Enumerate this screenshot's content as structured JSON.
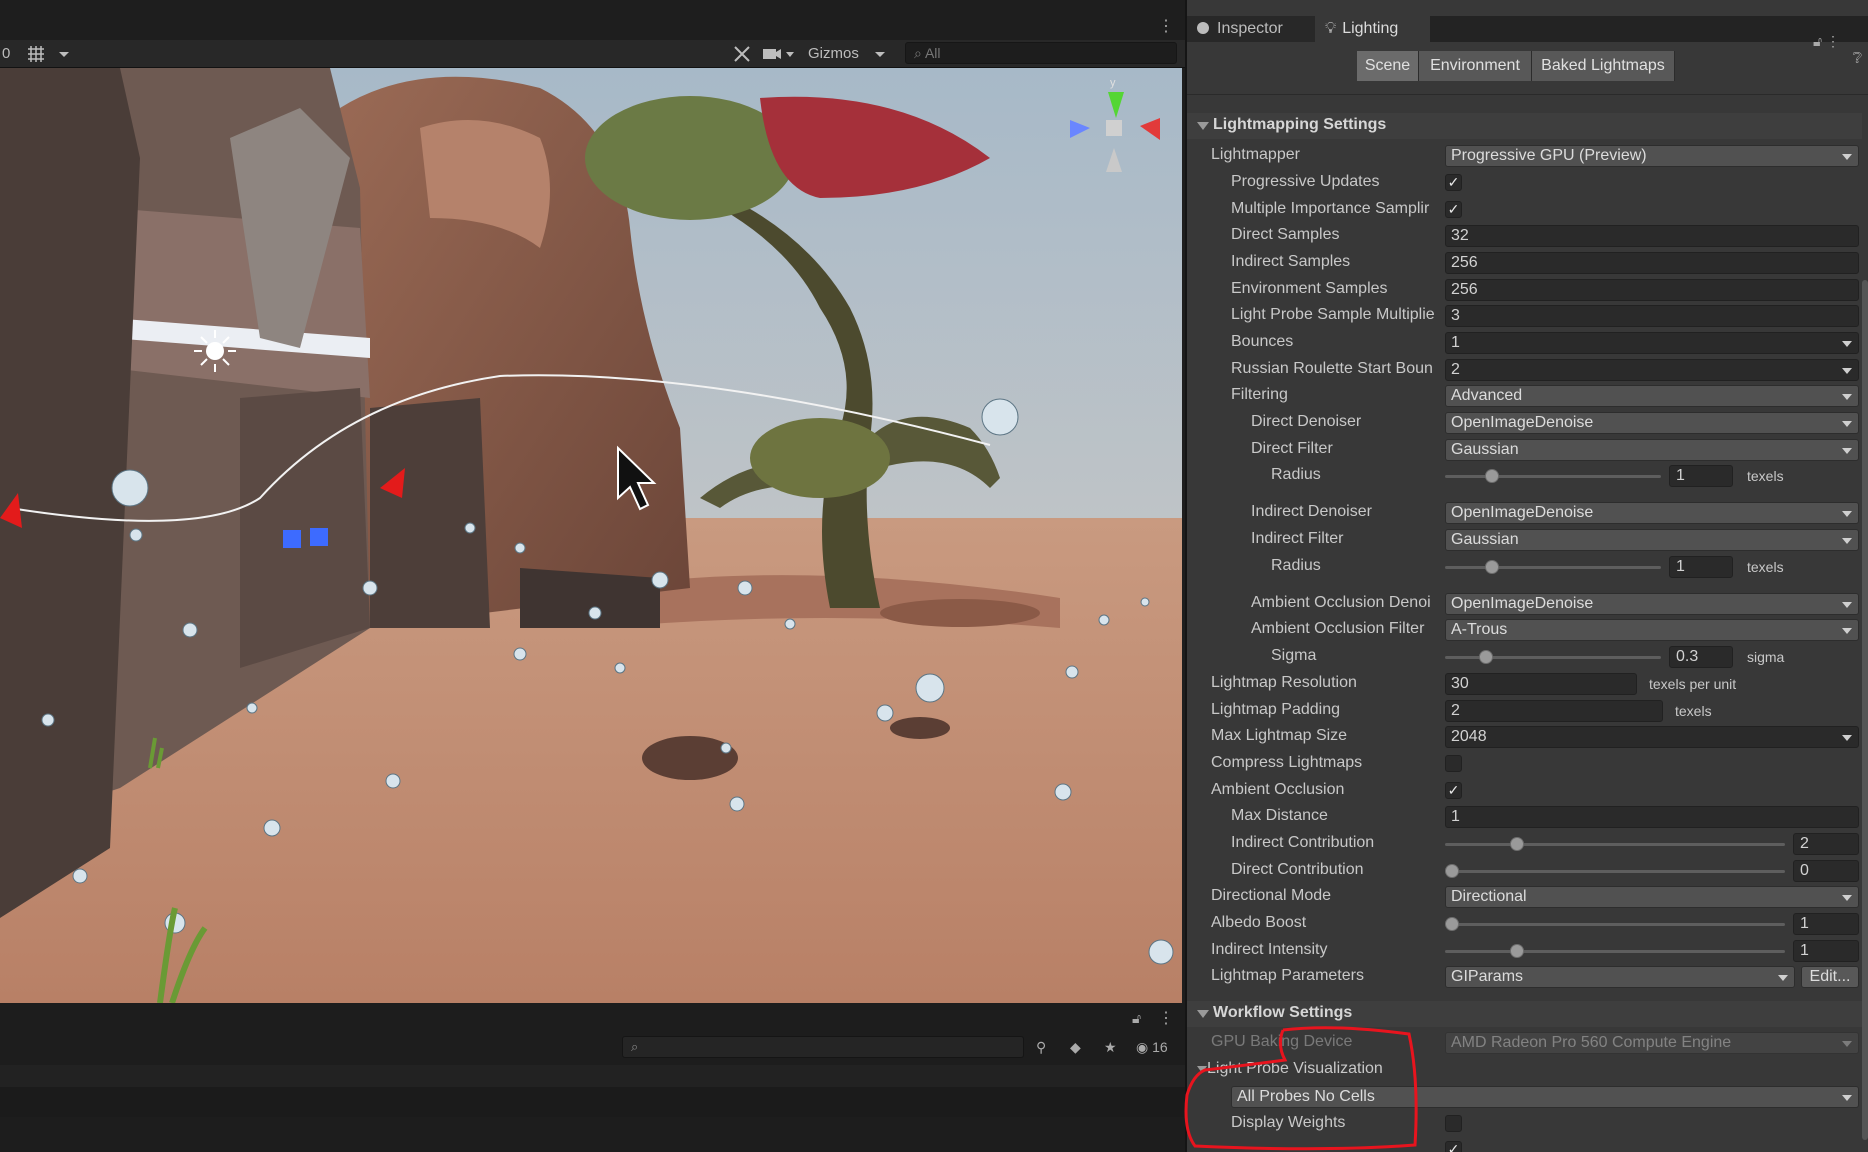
{
  "scene": {
    "gizmos_label": "Gizmos",
    "search_placeholder": "All",
    "layer_counter": "0",
    "hidden_count": "16",
    "gizmo_axis": "y"
  },
  "inspector": {
    "tabs": [
      {
        "label": "Inspector",
        "active": false
      },
      {
        "label": "Lighting",
        "active": true
      }
    ],
    "subtabs": [
      {
        "label": "Scene",
        "active": true
      },
      {
        "label": "Environment",
        "active": false
      },
      {
        "label": "Baked Lightmaps",
        "active": false
      }
    ],
    "lightmapping": {
      "title": "Lightmapping Settings",
      "lightmapper": {
        "label": "Lightmapper",
        "value": "Progressive GPU (Preview)"
      },
      "progressive_updates": {
        "label": "Progressive Updates",
        "checked": true
      },
      "mis": {
        "label": "Multiple Importance Samplir",
        "checked": true
      },
      "direct_samples": {
        "label": "Direct Samples",
        "value": "32"
      },
      "indirect_samples": {
        "label": "Indirect Samples",
        "value": "256"
      },
      "environment_samples": {
        "label": "Environment Samples",
        "value": "256"
      },
      "lp_multiplier": {
        "label": "Light Probe Sample Multiplie",
        "value": "3"
      },
      "bounces": {
        "label": "Bounces",
        "value": "1"
      },
      "rr_start": {
        "label": "Russian Roulette Start Boun",
        "value": "2"
      },
      "filtering": {
        "label": "Filtering",
        "value": "Advanced"
      },
      "direct_denoiser": {
        "label": "Direct Denoiser",
        "value": "OpenImageDenoise"
      },
      "direct_filter": {
        "label": "Direct Filter",
        "value": "Gaussian"
      },
      "direct_radius": {
        "label": "Radius",
        "value": "1",
        "unit": "texels",
        "fraction": 0.2
      },
      "indirect_denoiser": {
        "label": "Indirect Denoiser",
        "value": "OpenImageDenoise"
      },
      "indirect_filter": {
        "label": "Indirect Filter",
        "value": "Gaussian"
      },
      "indirect_radius": {
        "label": "Radius",
        "value": "1",
        "unit": "texels",
        "fraction": 0.2
      },
      "ao_denoiser": {
        "label": "Ambient Occlusion Denoi",
        "value": "OpenImageDenoise"
      },
      "ao_filter": {
        "label": "Ambient Occlusion Filter",
        "value": "A-Trous"
      },
      "sigma": {
        "label": "Sigma",
        "value": "0.3",
        "unit": "sigma",
        "fraction": 0.17
      },
      "lightmap_resolution": {
        "label": "Lightmap Resolution",
        "value": "30",
        "unit": "texels per unit"
      },
      "lightmap_padding": {
        "label": "Lightmap Padding",
        "value": "2",
        "unit": "texels"
      },
      "max_lightmap_size": {
        "label": "Max Lightmap Size",
        "value": "2048"
      },
      "compress_lightmaps": {
        "label": "Compress Lightmaps",
        "checked": false
      },
      "ambient_occlusion": {
        "label": "Ambient Occlusion",
        "checked": true
      },
      "max_distance": {
        "label": "Max Distance",
        "value": "1"
      },
      "indirect_contribution": {
        "label": "Indirect Contribution",
        "value": "2",
        "fraction": 0.2
      },
      "direct_contribution": {
        "label": "Direct Contribution",
        "value": "0",
        "fraction": 0.0
      },
      "directional_mode": {
        "label": "Directional Mode",
        "value": "Directional"
      },
      "albedo_boost": {
        "label": "Albedo Boost",
        "value": "1",
        "fraction": 0.0
      },
      "indirect_intensity": {
        "label": "Indirect Intensity",
        "value": "1",
        "fraction": 0.2
      },
      "lightmap_parameters": {
        "label": "Lightmap Parameters",
        "value": "GIParams",
        "edit": "Edit..."
      }
    },
    "workflow": {
      "title": "Workflow Settings",
      "gpu_device": {
        "label": "GPU Baking Device",
        "value": "AMD Radeon Pro 560 Compute Engine"
      },
      "lp_visualization": {
        "label": "Light Probe Visualization"
      },
      "lp_mode": {
        "value": "All Probes No Cells"
      },
      "display_weights": {
        "label": "Display Weights",
        "checked": false
      }
    }
  },
  "colors": {
    "panel": "#383838",
    "field": "#2a2a2a",
    "dropdown": "#515151",
    "annotation": "#e8141e",
    "sky": "#c3ccd2",
    "sand": "#c49278"
  }
}
